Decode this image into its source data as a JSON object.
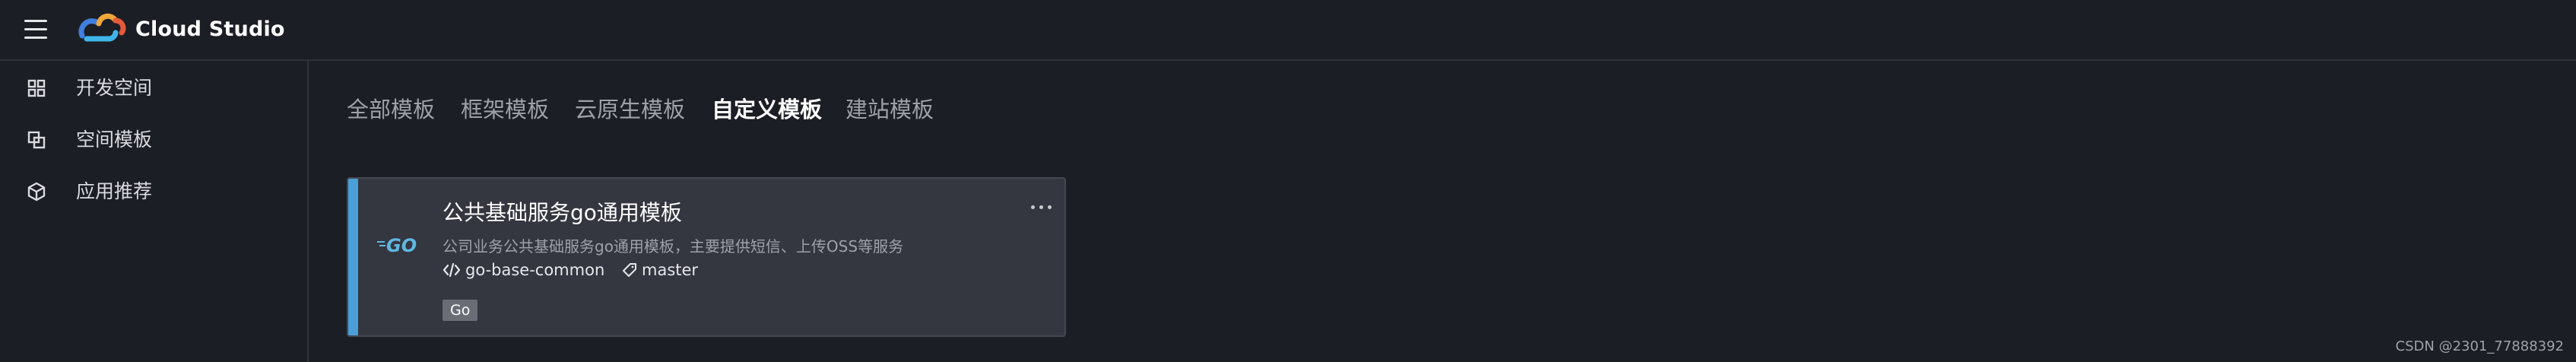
{
  "app": {
    "title": "Cloud Studio",
    "colors": {
      "background": "#1c1e25",
      "card": "#343640",
      "accent": "#4a9fd8",
      "tag": "#6a6d76"
    }
  },
  "header": {
    "menu_icon": "hamburger-menu-icon",
    "logo_icon": "cloud-studio-logo-icon"
  },
  "sidebar": {
    "items": [
      {
        "label": "开发空间",
        "icon": "grid-icon"
      },
      {
        "label": "空间模板",
        "icon": "copy-icon"
      },
      {
        "label": "应用推荐",
        "icon": "cube-icon"
      }
    ]
  },
  "tabs": [
    {
      "label": "全部模板",
      "active": false
    },
    {
      "label": "框架模板",
      "active": false
    },
    {
      "label": "云原生模板",
      "active": false
    },
    {
      "label": "自定义模板",
      "active": true
    },
    {
      "label": "建站模板",
      "active": false
    }
  ],
  "card": {
    "logo_icon": "go-logo-icon",
    "title": "公共基础服务go通用模板",
    "description": "公司业务公共基础服务go通用模板，主要提供短信、上传OSS等服务",
    "repo_icon": "code-icon",
    "repo": "go-base-common",
    "branch_icon": "tag-icon",
    "branch": "master",
    "tag": "Go",
    "more_icon": "more-horizontal-icon"
  },
  "footer": {
    "watermark": "CSDN @2301_77888392"
  }
}
